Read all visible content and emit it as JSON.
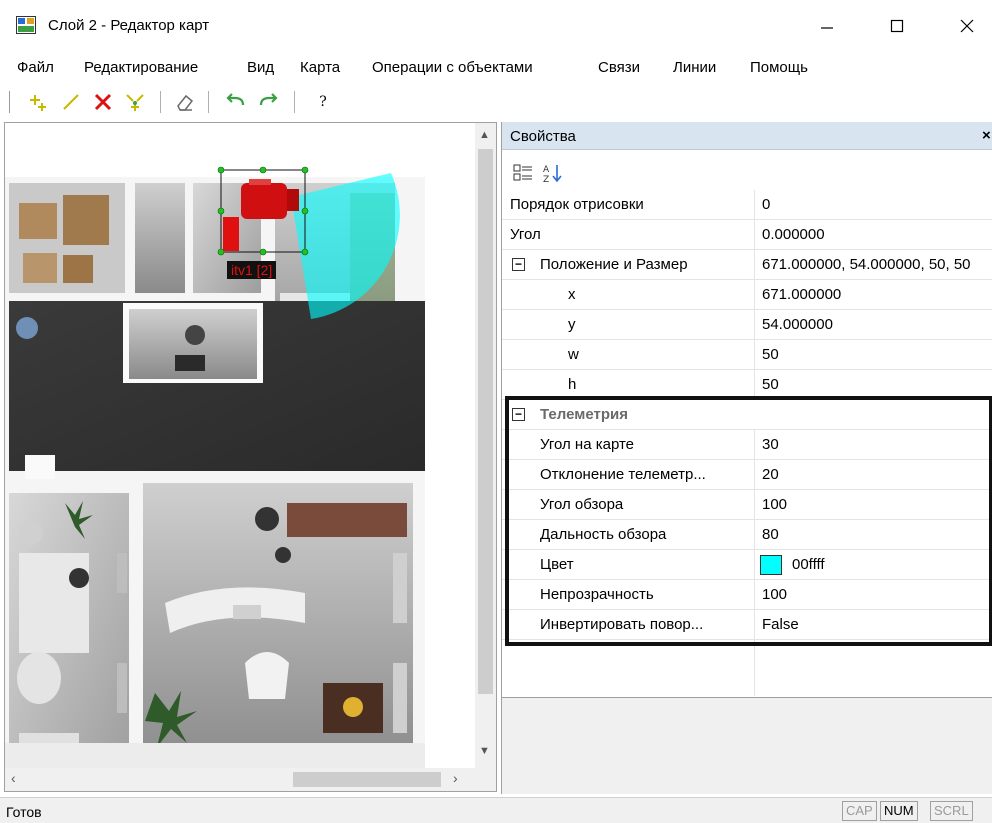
{
  "window": {
    "title": "Слой 2 - Редактор карт",
    "controls": {
      "minimize": "—",
      "maximize": "☐",
      "close": "✕"
    }
  },
  "menu": [
    "Файл",
    "Редактирование",
    "Вид",
    "Карта",
    "Операции с объектами",
    "Связи",
    "Линии",
    "Помощь"
  ],
  "toolbar": {
    "buttons": [
      "add-object-icon",
      "draw-line-icon",
      "delete-icon",
      "sparkle-select-icon",
      "eraser-icon",
      "undo-icon",
      "redo-icon",
      "help-icon"
    ],
    "help_label": "?"
  },
  "map": {
    "camera_label": "itv1  [2]",
    "camera_color": "#e01010",
    "view_cone_color": "#00ffff"
  },
  "properties": {
    "title": "Свойства",
    "close_label": "×",
    "rows": [
      {
        "name": "Порядок отрисовки",
        "value": "0"
      },
      {
        "name": "Угол",
        "value": "0.000000"
      },
      {
        "name": "Положение и Размер",
        "value": "671.000000, 54.000000, 50, 50"
      },
      {
        "name": "x",
        "value": "671.000000"
      },
      {
        "name": "y",
        "value": "54.000000"
      },
      {
        "name": "w",
        "value": "50"
      },
      {
        "name": "h",
        "value": "50"
      }
    ],
    "telemetry_category": "Телеметрия",
    "telemetry_rows": [
      {
        "name": "Угол на карте",
        "value": "30"
      },
      {
        "name": "Отклонение телеметр...",
        "value": "20"
      },
      {
        "name": "Угол обзора",
        "value": "100"
      },
      {
        "name": "Дальность обзора",
        "value": "80"
      },
      {
        "name": "Цвет",
        "value": "00ffff",
        "swatch": "#00ffff"
      },
      {
        "name": "Непрозрачность",
        "value": "100"
      },
      {
        "name": "Инвертировать повор...",
        "value": "False"
      }
    ],
    "expander_symbol": "⊟"
  },
  "status": {
    "text": "Готов",
    "indicators": [
      "CAP",
      "NUM",
      "SCRL"
    ]
  }
}
